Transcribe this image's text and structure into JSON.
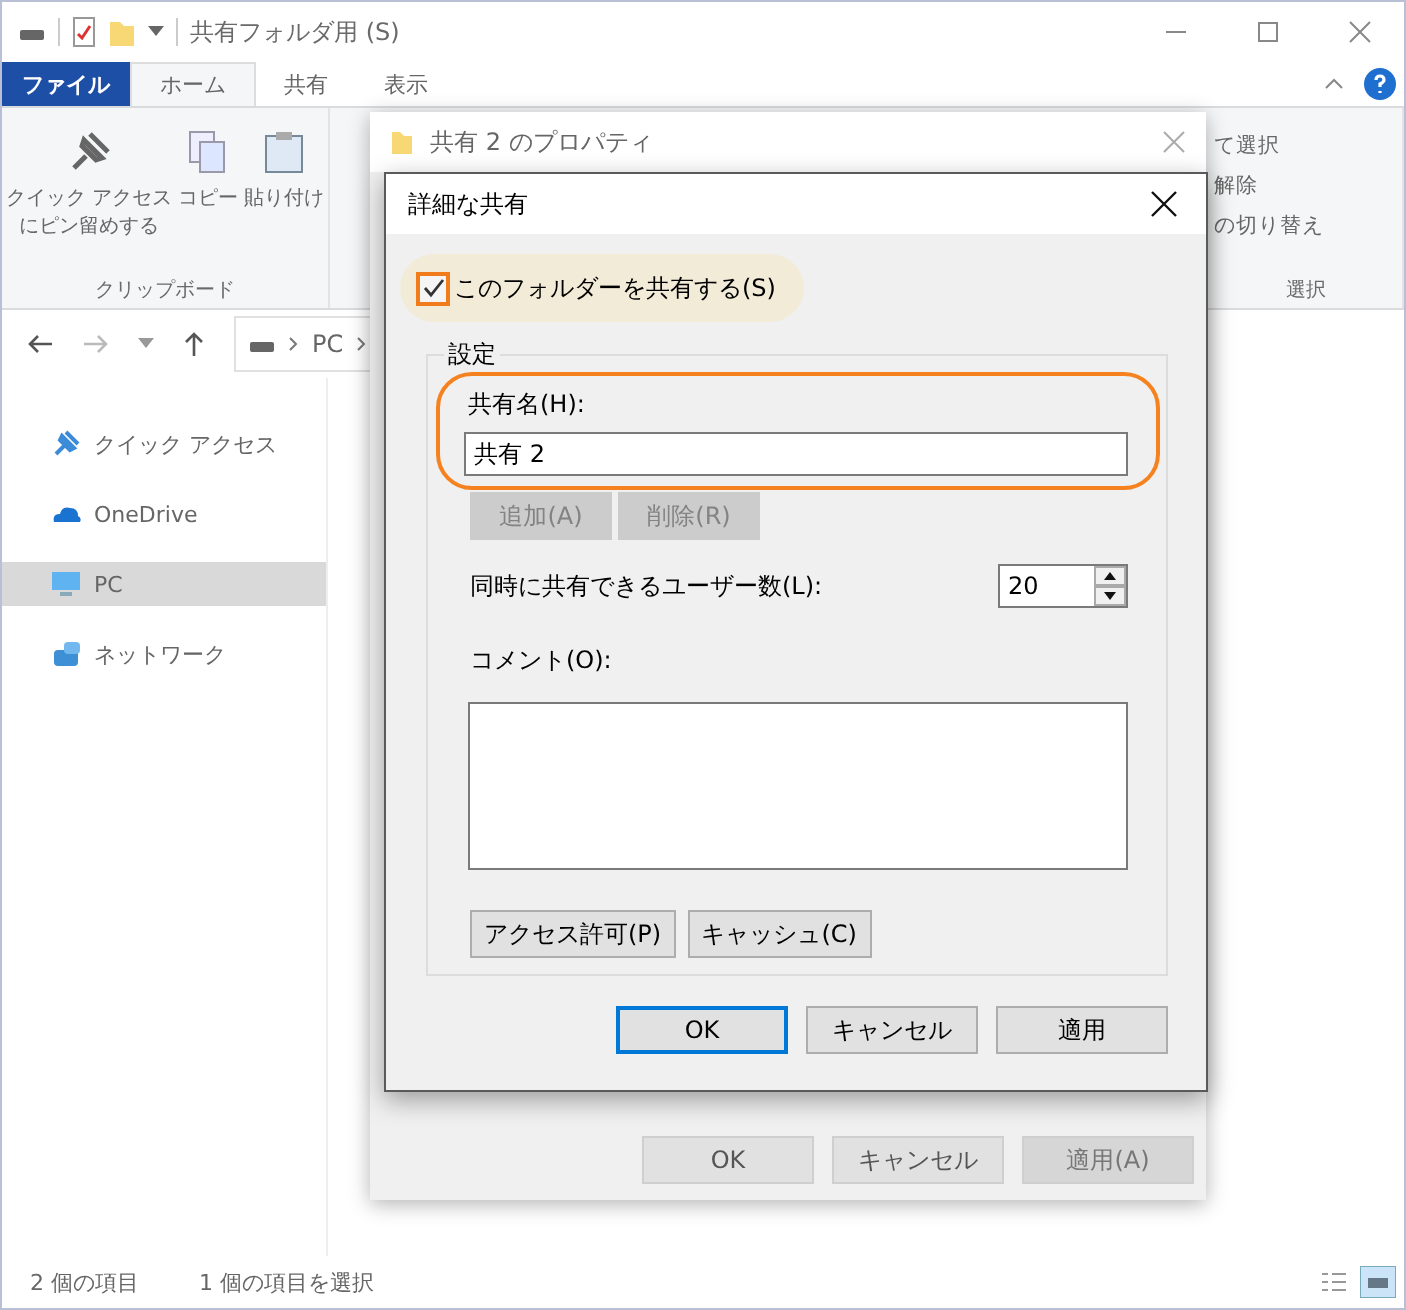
{
  "explorer": {
    "title": "共有フォルダ用 (S)",
    "ribbon_tabs": [
      {
        "label": "ファイル",
        "kind": "file",
        "selected": false
      },
      {
        "label": "ホーム",
        "kind": "tab",
        "selected": true
      },
      {
        "label": "共有",
        "kind": "tab",
        "selected": false
      },
      {
        "label": "表示",
        "kind": "tab",
        "selected": false
      }
    ],
    "ribbon_commands": [
      {
        "label_lines": [
          "クイック アクセス",
          "にピン留めする"
        ],
        "kind": "pin"
      },
      {
        "label_lines": [
          "コピー"
        ],
        "kind": "copy"
      },
      {
        "label_lines": [
          "貼り付け"
        ],
        "kind": "paste"
      }
    ],
    "ribbon_group": "クリップボード",
    "ribbon_select_commands": [
      "て選択",
      "解除",
      "の切り替え"
    ],
    "ribbon_select_group": "選択",
    "address": "PC",
    "nav_items": [
      {
        "label": "クイック アクセス",
        "kind": "pin",
        "selected": false
      },
      {
        "label": "OneDrive",
        "kind": "cloud",
        "selected": false
      },
      {
        "label": "PC",
        "kind": "pc",
        "selected": true
      },
      {
        "label": "ネットワーク",
        "kind": "network",
        "selected": false
      }
    ],
    "status_bar": [
      "2 個の項目",
      "1 個の項目を選択"
    ]
  },
  "properties_dialog": {
    "title": "共有 2 のプロパティ",
    "buttons": [
      {
        "label": "OK",
        "disabled": false
      },
      {
        "label": "キャンセル",
        "disabled": false
      },
      {
        "label": "適用(A)",
        "disabled": true
      }
    ]
  },
  "sharing_dialog": {
    "title": "詳細な共有",
    "share_checkbox": {
      "label": "このフォルダーを共有する(S)",
      "checked": true
    },
    "settings_group": "設定",
    "share_name_label": "共有名(H):",
    "share_name": "共有 2",
    "name_buttons": [
      {
        "label": "追加(A)",
        "disabled": true
      },
      {
        "label": "削除(R)",
        "disabled": true
      }
    ],
    "user_limit_label": "同時に共有できるユーザー数(L):",
    "user_limit": "20",
    "comment_label": "コメント(O):",
    "action_buttons": [
      {
        "label": "アクセス許可(P)",
        "disabled": false
      },
      {
        "label": "キャッシュ(C)",
        "disabled": false
      }
    ],
    "buttons": [
      {
        "label": "OK",
        "default": true
      },
      {
        "label": "キャンセル",
        "default": false
      },
      {
        "label": "適用",
        "default": false
      }
    ]
  }
}
